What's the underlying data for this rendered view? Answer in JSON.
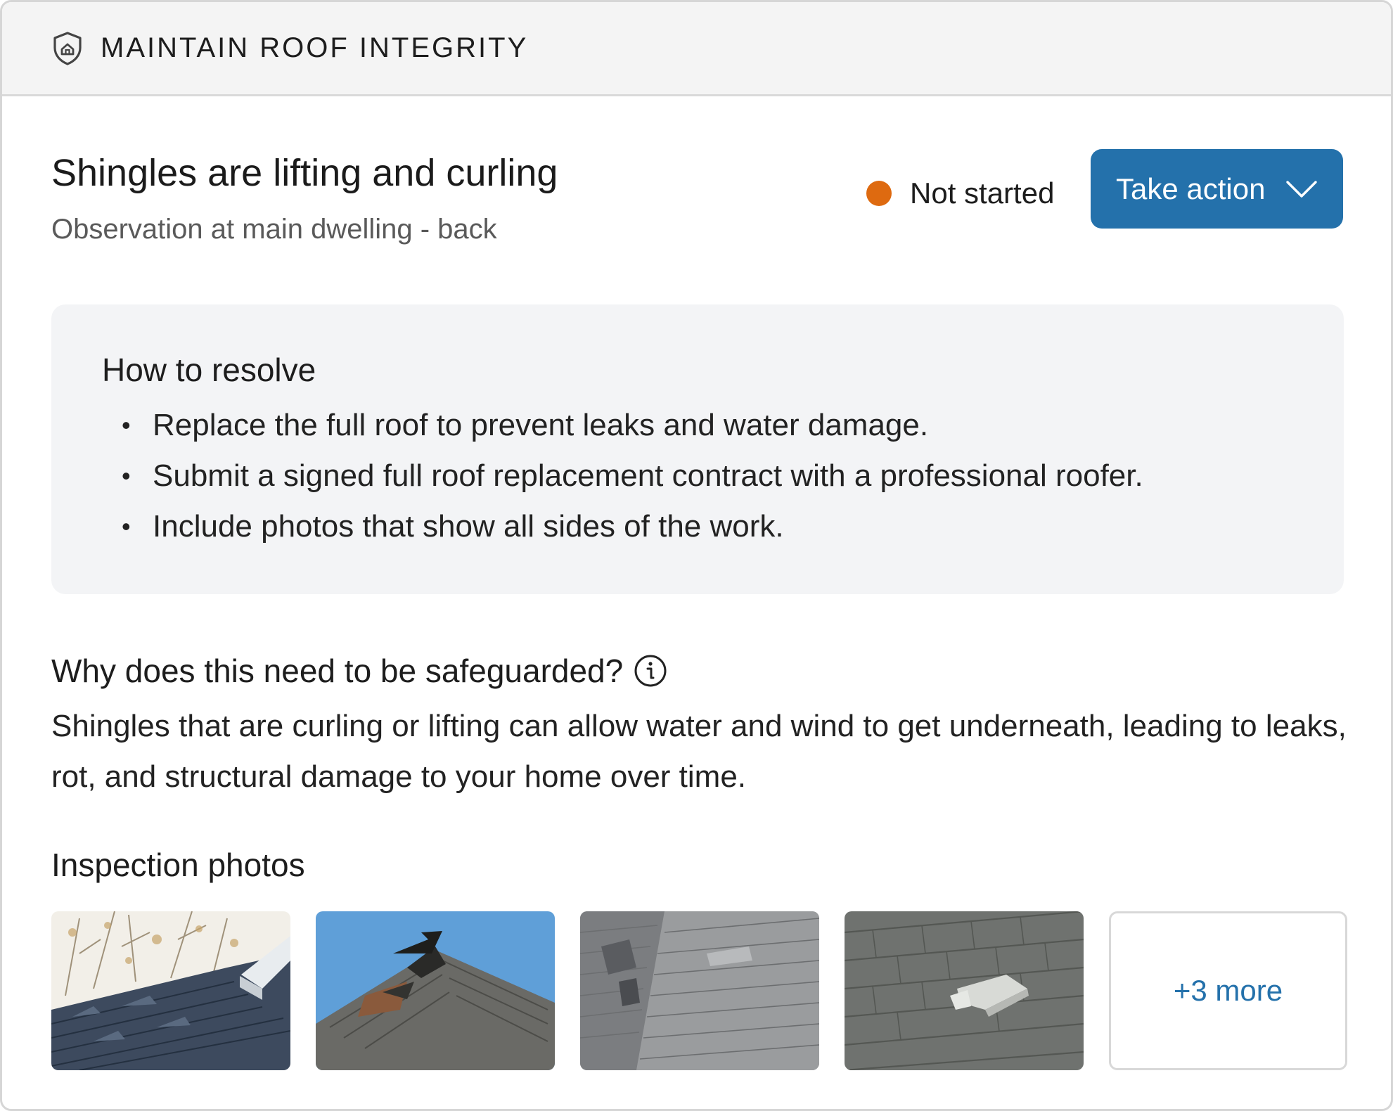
{
  "header": {
    "title": "MAINTAIN ROOF INTEGRITY",
    "icon": "shield-home-icon"
  },
  "issue": {
    "title": "Shingles are lifting and curling",
    "subtitle": "Observation at main dwelling - back",
    "status": {
      "label": "Not started",
      "color": "#de6a10"
    },
    "action_button": {
      "label": "Take action",
      "icon": "chevron-down-icon",
      "color": "#2471ab"
    }
  },
  "resolve": {
    "title": "How to resolve",
    "items": [
      "Replace the full roof to prevent leaks and water damage.",
      "Submit a signed full roof replacement contract with a professional roofer.",
      "Include photos that show all sides of the work."
    ]
  },
  "why": {
    "title": "Why does this need to be safeguarded?",
    "icon": "info-icon",
    "text": "Shingles that are curling or lifting can allow water and wind to get underneath, leading to leaks, rot, and structural damage to your home over time."
  },
  "photos": {
    "title": "Inspection photos",
    "more_label": "+3 more"
  }
}
